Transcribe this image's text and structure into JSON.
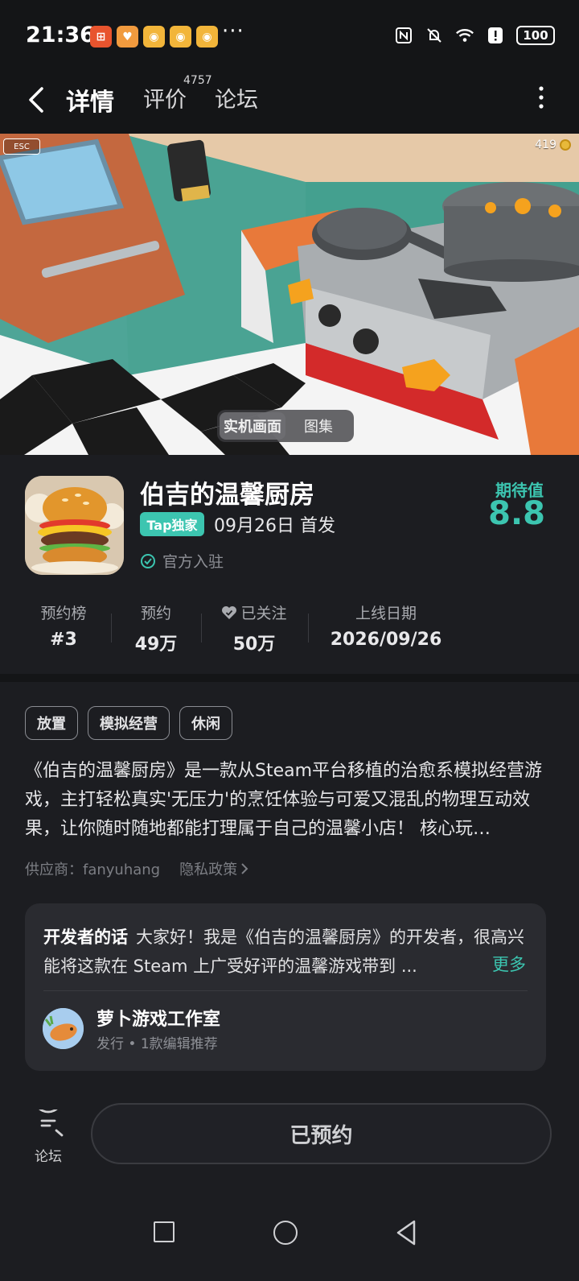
{
  "status": {
    "time": "21:36",
    "more": "···",
    "battery": "100"
  },
  "nav": {
    "tab_detail": "详情",
    "tab_review": "评价",
    "review_count": "4757",
    "tab_forum": "论坛"
  },
  "hero": {
    "esc": "ESC",
    "coins": "419",
    "media_tabs": [
      "实机画面",
      "图集"
    ]
  },
  "game": {
    "title": "伯吉的温馨厨房",
    "badge": "Tap独家",
    "release": "09月26日 首发",
    "official": "官方入驻",
    "expect_label": "期待值",
    "expect_value": "8.8"
  },
  "stats": [
    {
      "label": "预约榜",
      "value": "#3"
    },
    {
      "label": "预约",
      "value": "49万"
    },
    {
      "label": "已关注",
      "value": "50万"
    },
    {
      "label": "上线日期",
      "value": "2026/09/26"
    }
  ],
  "tags": [
    "放置",
    "模拟经营",
    "休闲"
  ],
  "description": "《伯吉的温馨厨房》是一款从Steam平台移植的治愈系模拟经营游戏，主打轻松真实'无压力'的烹饪体验与可爱又混乱的物理互动效果，让你随时随地都能打理属于自己的温馨小店！ 核心玩…",
  "supplier": {
    "text": "供应商：fanyuhang",
    "privacy": "隐私政策"
  },
  "developer": {
    "title": "开发者的话",
    "text": "大家好！我是《伯吉的温馨厨房》的开发者，很高兴能将这款在 Steam 上广受好评的温馨游戏带到 ...",
    "more": "更多",
    "studio": "萝卜游戏工作室",
    "sub": "发行 • 1款编辑推荐"
  },
  "bottom": {
    "forum": "论坛",
    "reserve": "已预约"
  },
  "colors": {
    "accent": "#3cc5b0",
    "background": "#1c1d21",
    "card": "#2a2b30"
  }
}
